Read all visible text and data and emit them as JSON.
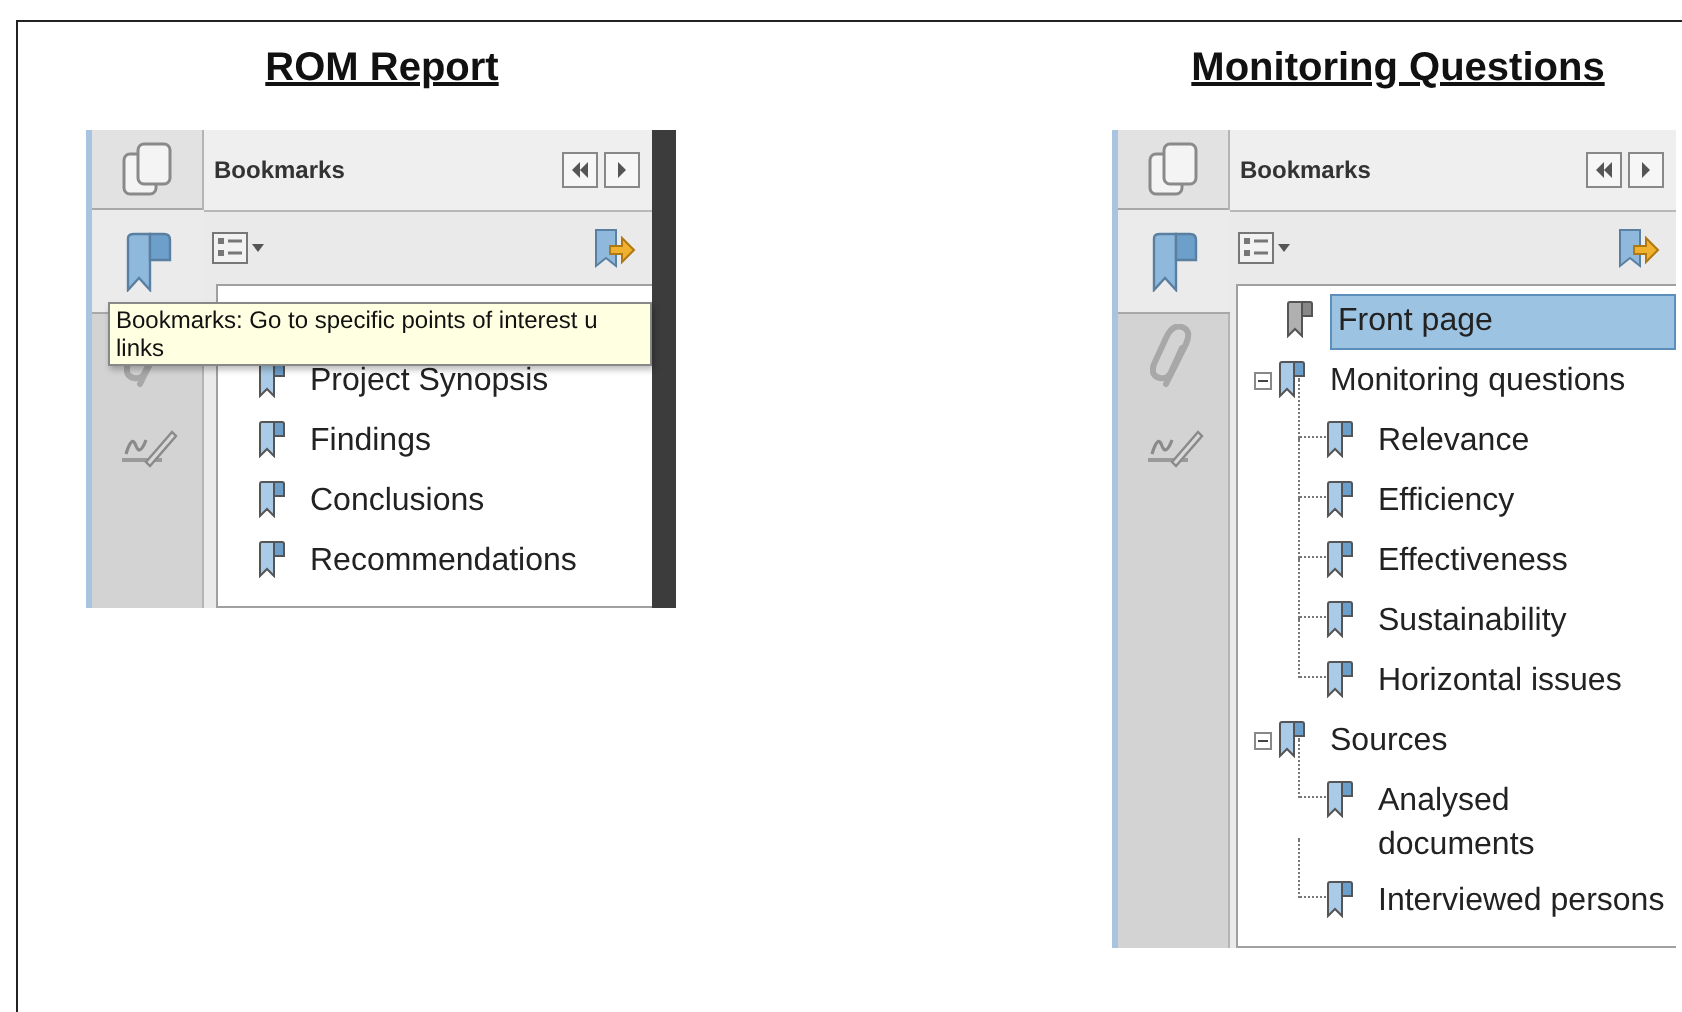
{
  "panels": [
    {
      "heading": "ROM Report",
      "title": "Bookmarks",
      "side_tabs": [
        {
          "kind": "pages",
          "selected": false
        },
        {
          "kind": "bookmarks",
          "selected": true
        },
        {
          "kind": "attachments",
          "selected": false
        },
        {
          "kind": "signatures",
          "selected": false
        }
      ],
      "tooltip": {
        "lines": [
          "Bookmarks: Go to specific points of interest u",
          "links"
        ]
      },
      "items": [
        {
          "label": "Project Synopsis",
          "selected": false
        },
        {
          "label": "Findings",
          "selected": false
        },
        {
          "label": "Conclusions",
          "selected": false
        },
        {
          "label": "Recommendations",
          "selected": false
        }
      ]
    },
    {
      "heading": "Monitoring Questions",
      "title": "Bookmarks",
      "side_tabs": [
        {
          "kind": "pages",
          "selected": false
        },
        {
          "kind": "bookmarks",
          "selected": true
        },
        {
          "kind": "attachments",
          "selected": false
        },
        {
          "kind": "signatures",
          "selected": false
        }
      ],
      "items": [
        {
          "label": "Front page",
          "selected": true
        },
        {
          "label": "Monitoring questions",
          "selected": false,
          "expanded": true,
          "children": [
            {
              "label": "Relevance",
              "selected": false
            },
            {
              "label": "Efficiency",
              "selected": false
            },
            {
              "label": "Effectiveness",
              "selected": false
            },
            {
              "label": "Sustainability",
              "selected": false
            },
            {
              "label": "Horizontal issues",
              "selected": false
            }
          ]
        },
        {
          "label": "Sources",
          "selected": false,
          "expanded": true,
          "children": [
            {
              "label": "Analysed documents",
              "selected": false
            },
            {
              "label": "Interviewed persons",
              "selected": false
            }
          ]
        }
      ]
    }
  ]
}
